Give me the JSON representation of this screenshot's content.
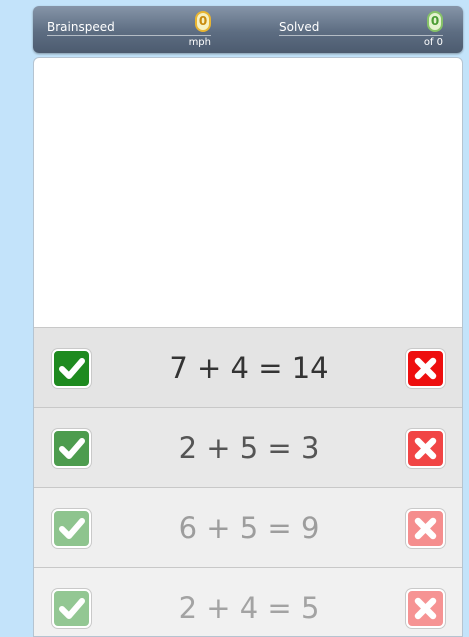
{
  "stats": {
    "brainspeed": {
      "label": "Brainspeed",
      "value": "0",
      "unit": "mph",
      "color": "#e9b531"
    },
    "solved": {
      "label": "Solved",
      "value": "0",
      "unit": "of 0",
      "color": "#86c268"
    }
  },
  "problems": [
    {
      "equation": "7 + 4 = 14"
    },
    {
      "equation": "2 + 5 = 3"
    },
    {
      "equation": "6 + 5 = 9"
    },
    {
      "equation": "2 + 4 = 5"
    }
  ],
  "icons": {
    "correct": "check-icon",
    "wrong": "x-icon"
  },
  "colors": {
    "background": "#c3e3fa",
    "correct": "#1e8a1f",
    "wrong": "#ee0f0f"
  }
}
